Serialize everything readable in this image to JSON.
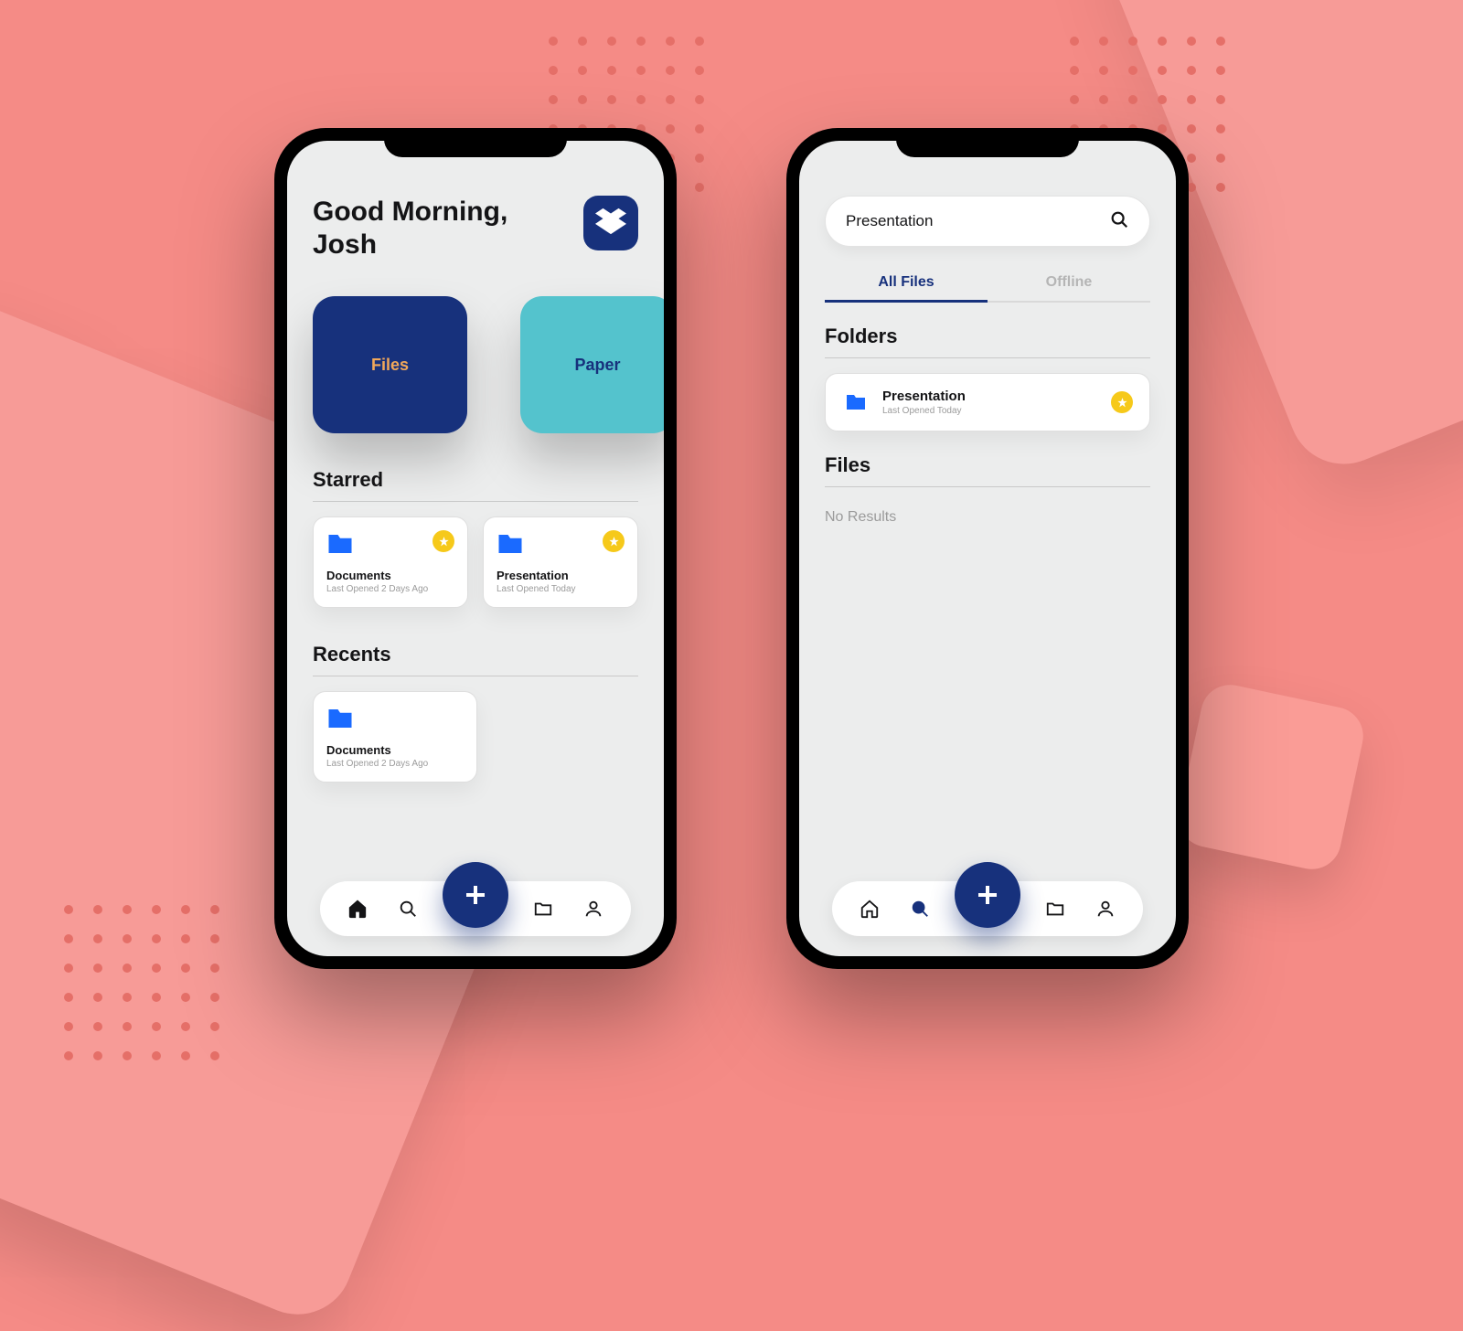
{
  "home": {
    "greeting_line1": "Good Morning,",
    "greeting_line2": "Josh",
    "tiles": {
      "files": "Files",
      "paper": "Paper"
    },
    "starred_title": "Starred",
    "starred_items": [
      {
        "name": "Documents",
        "sub": "Last Opened 2 Days Ago"
      },
      {
        "name": "Presentation",
        "sub": "Last Opened Today"
      }
    ],
    "recents_title": "Recents",
    "recents_items": [
      {
        "name": "Documents",
        "sub": "Last Opened 2 Days Ago"
      }
    ]
  },
  "search": {
    "query": "Presentation",
    "tabs": {
      "all": "All Files",
      "offline": "Offline"
    },
    "folders_title": "Folders",
    "folders": [
      {
        "name": "Presentation",
        "sub": "Last Opened Today"
      }
    ],
    "files_title": "Files",
    "no_results": "No Results"
  },
  "icons": {
    "app": "dropbox-icon",
    "search": "search-icon",
    "home": "home-icon",
    "folder": "folder-icon",
    "user": "user-icon",
    "add": "plus-icon",
    "star": "star-icon"
  },
  "colors": {
    "brand": "#17317c",
    "teal": "#54c3cd",
    "accent": "#f2a85a",
    "star": "#f6c91a",
    "folder": "#1a6aff",
    "bg": "#f58b86"
  }
}
